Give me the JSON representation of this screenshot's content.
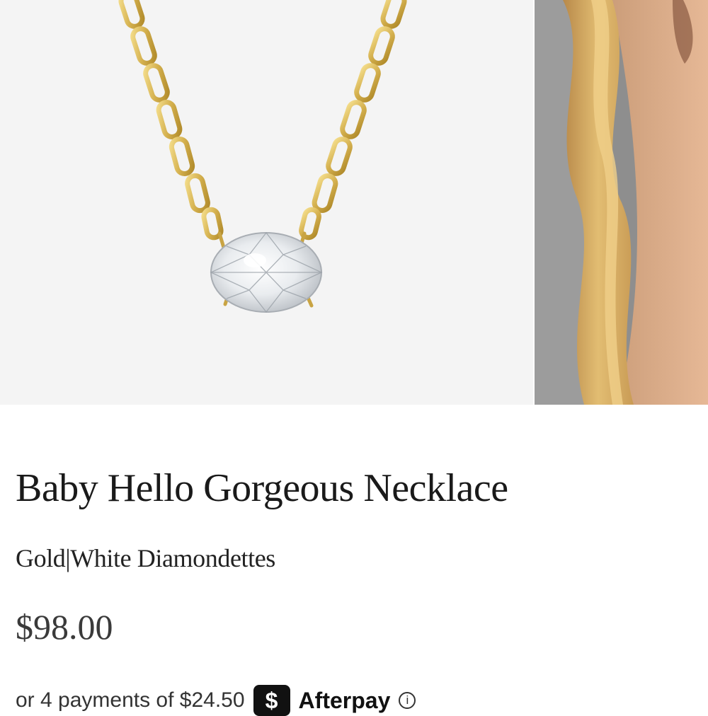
{
  "product": {
    "name": "Baby Hello Gorgeous Necklace",
    "variant": "Gold|White Diamondettes",
    "price": "$98.00"
  },
  "afterpay": {
    "text": "or 4 payments of $24.50",
    "logo_symbol": "$",
    "brand": "Afterpay",
    "info_symbol": "i"
  },
  "gallery": {
    "icons": [
      "necklace-product-image",
      "model-wearing-image"
    ]
  }
}
